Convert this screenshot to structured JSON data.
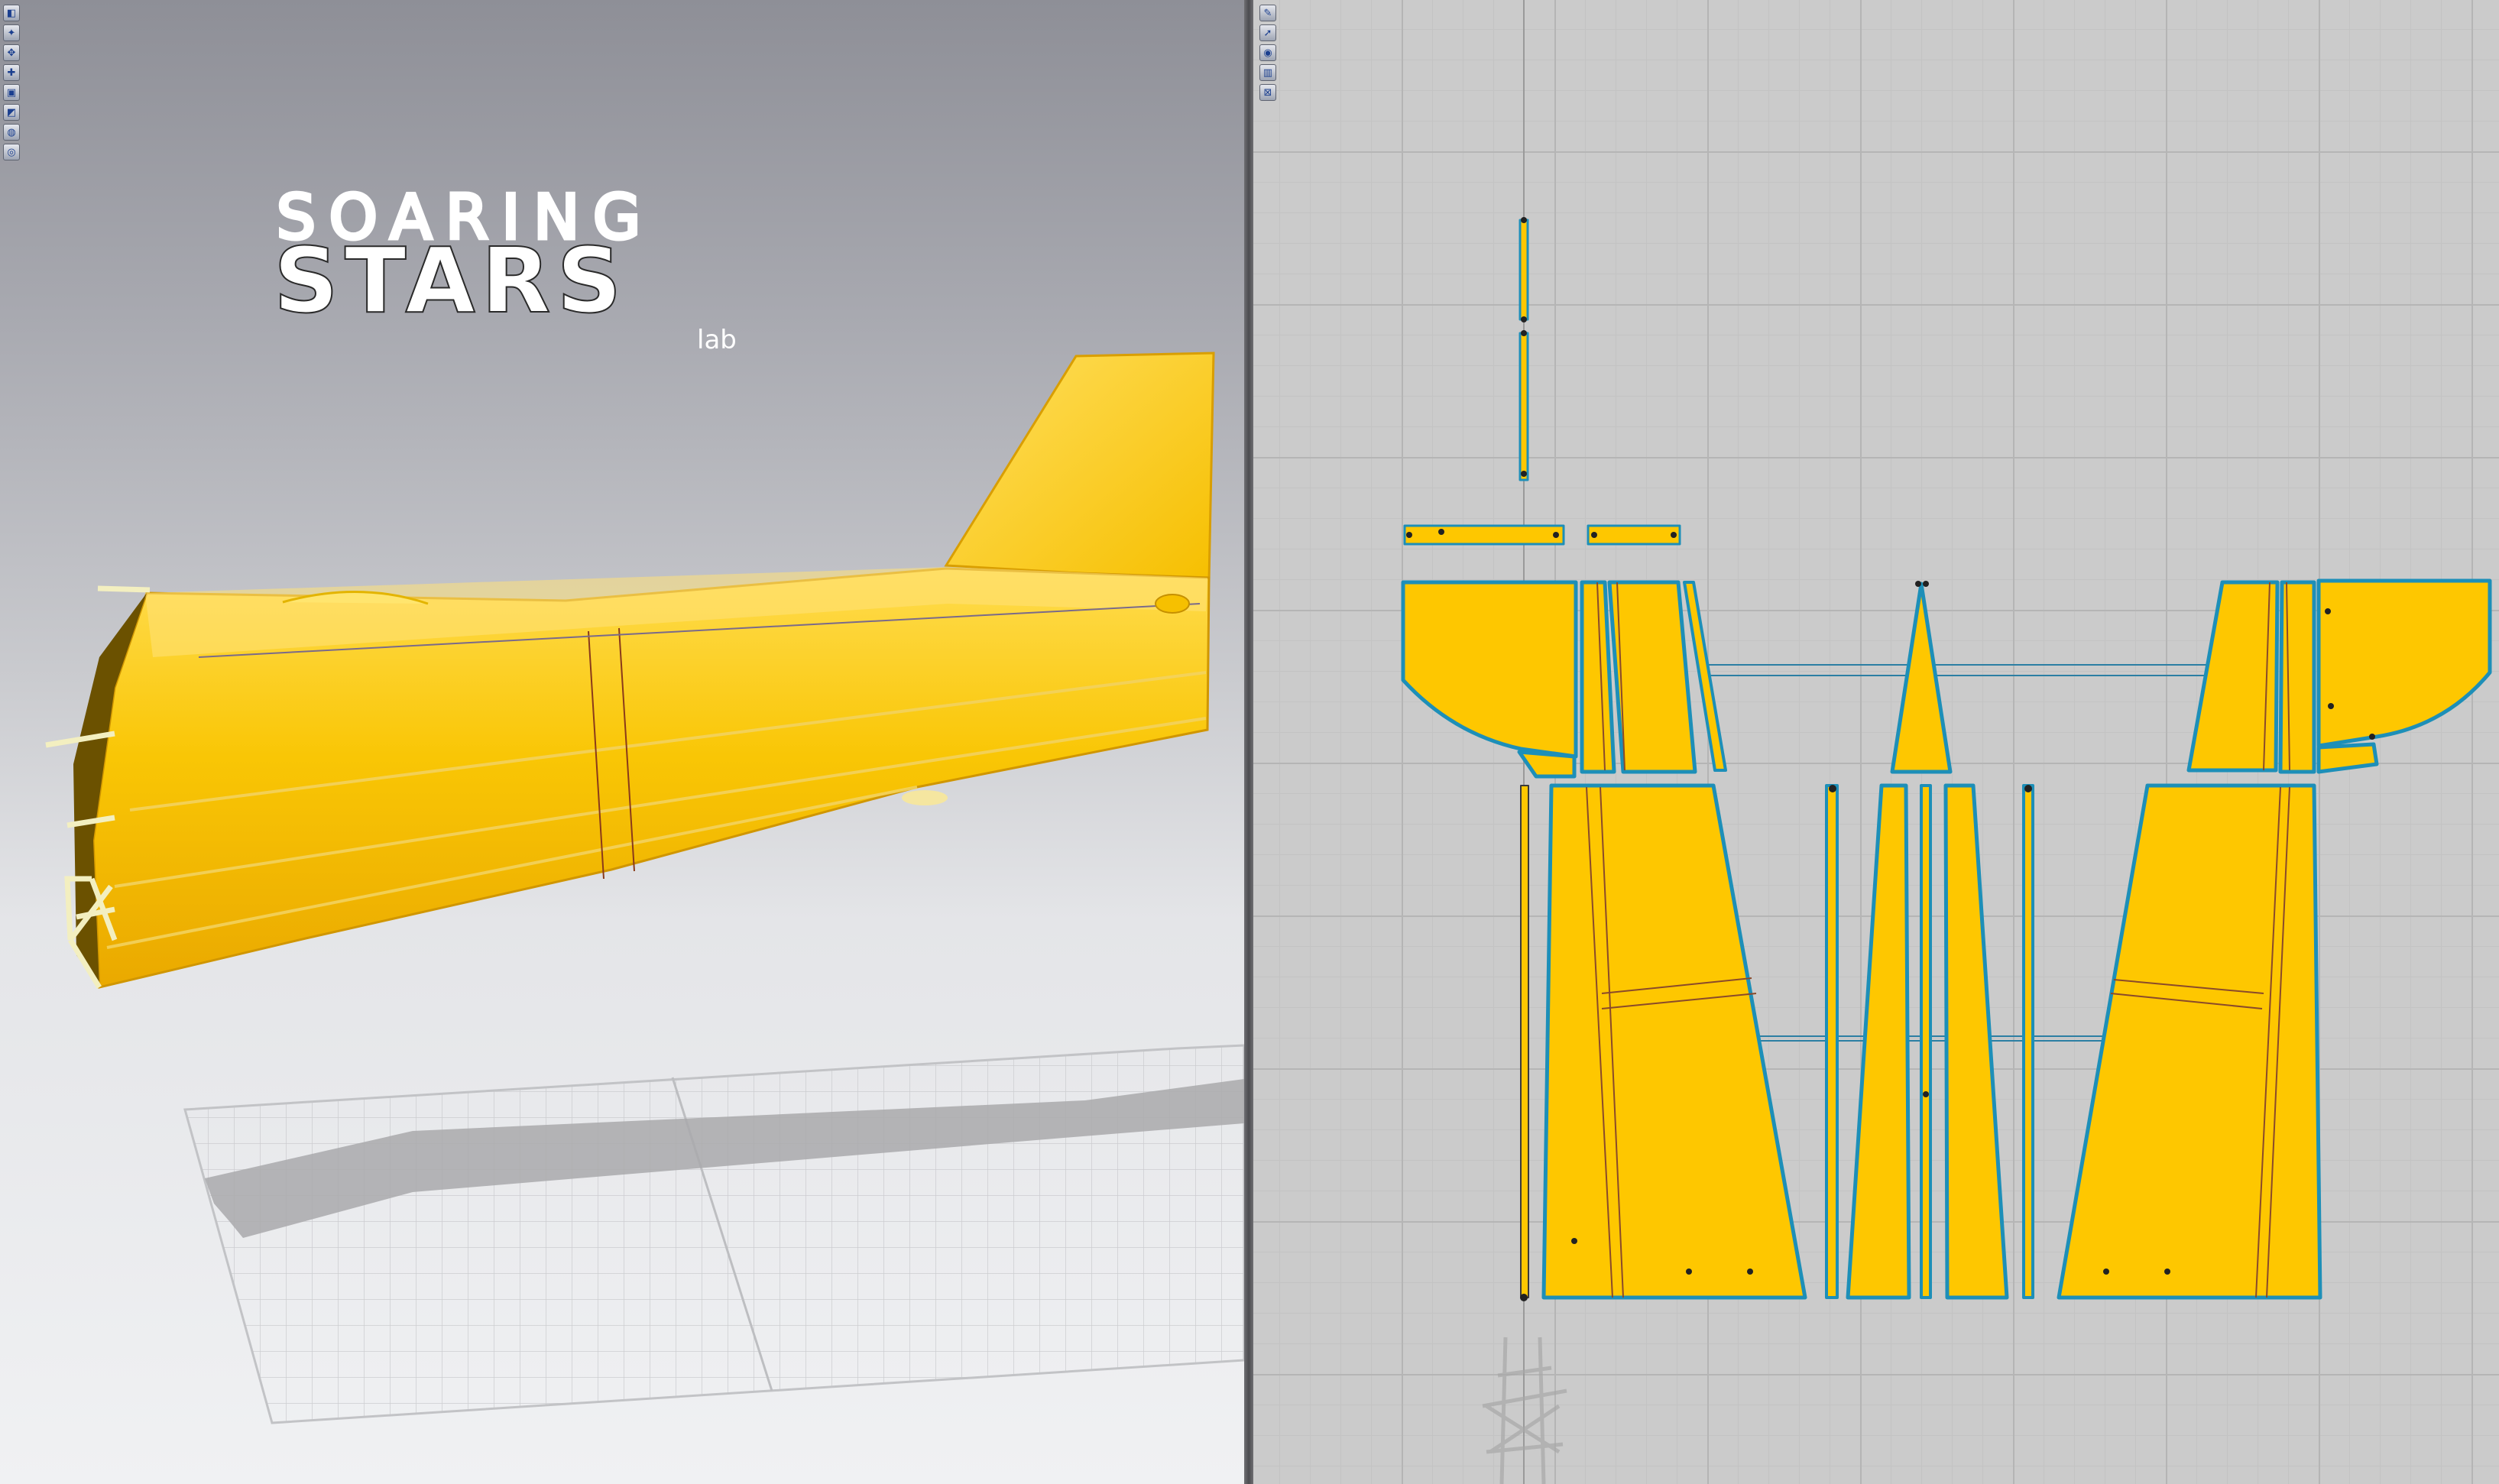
{
  "logo": {
    "line1": "SOARING",
    "line2": "STARS",
    "line3": "lab"
  },
  "toolbar_left": {
    "tools": [
      {
        "icon": "camera-icon",
        "glyph": "◧"
      },
      {
        "icon": "tools-icon",
        "glyph": "✦"
      },
      {
        "icon": "select-icon",
        "glyph": "✥"
      },
      {
        "icon": "transform-icon",
        "glyph": "✚"
      },
      {
        "icon": "cube-icon",
        "glyph": "▣"
      },
      {
        "icon": "surface-icon",
        "glyph": "◩"
      },
      {
        "icon": "bulb-icon",
        "glyph": "◍"
      },
      {
        "icon": "render-icon",
        "glyph": "◎"
      }
    ]
  },
  "toolbar_right": {
    "tools": [
      {
        "icon": "wrench-icon",
        "glyph": "✎"
      },
      {
        "icon": "pointer-icon",
        "glyph": "➚"
      },
      {
        "icon": "globe-icon",
        "glyph": "◉"
      },
      {
        "icon": "layer-icon",
        "glyph": "▥"
      },
      {
        "icon": "lock-icon",
        "glyph": "⊠"
      }
    ]
  },
  "colors": {
    "part_fill": "#fec700",
    "part_outline": "#1d8fb8",
    "body_yellow": "#f8c400",
    "body_highlight": "#ffde55"
  }
}
